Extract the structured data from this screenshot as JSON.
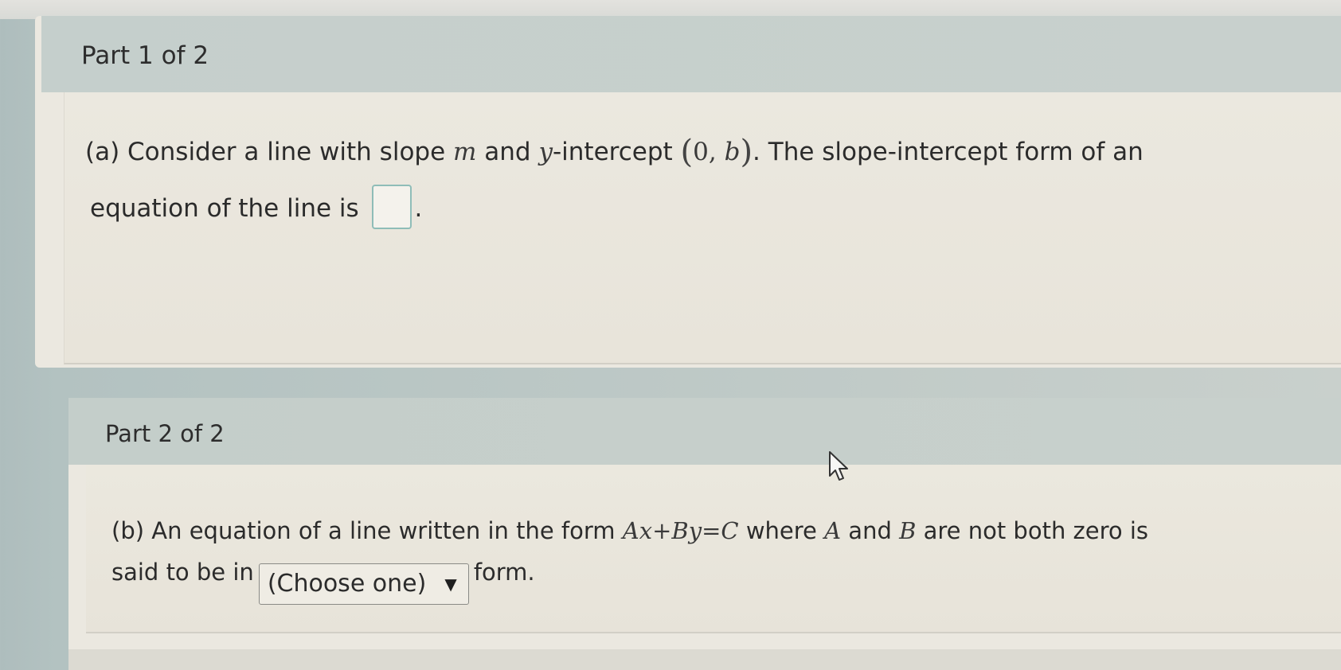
{
  "part1": {
    "title": "Part 1 of 2",
    "question": {
      "prefix": "(a) Consider a line with slope ",
      "var_m": "m",
      "and": " and ",
      "var_y": "y",
      "intercept_text": "-intercept ",
      "point_open": "(",
      "point_zero": "0, ",
      "point_b": "b",
      "point_close": ")",
      "suffix": ". The slope-intercept form of an",
      "line2": "equation of the line is",
      "period": "."
    }
  },
  "part2": {
    "title": "Part 2 of 2",
    "question": {
      "prefix": "(b) An equation of a line written in the form ",
      "eq_A": "A",
      "eq_x": "x",
      "eq_plus": "+",
      "eq_B": "B",
      "eq_y": "y",
      "eq_equals": "=",
      "eq_C": "C",
      "where": " where ",
      "var_A": "A",
      "and": " and ",
      "var_B": "B",
      "suffix": " are not both zero is",
      "line2_prefix": "said to be in",
      "select_value": "(Choose one)",
      "line2_suffix": "form."
    }
  },
  "colors": {
    "header_bg": "#c5cfcc",
    "body_bg": "#ebe8e0",
    "answer_border": "#8fbdb8"
  },
  "icons": {
    "dropdown": "caret-down-icon",
    "cursor": "mouse-pointer-icon"
  }
}
